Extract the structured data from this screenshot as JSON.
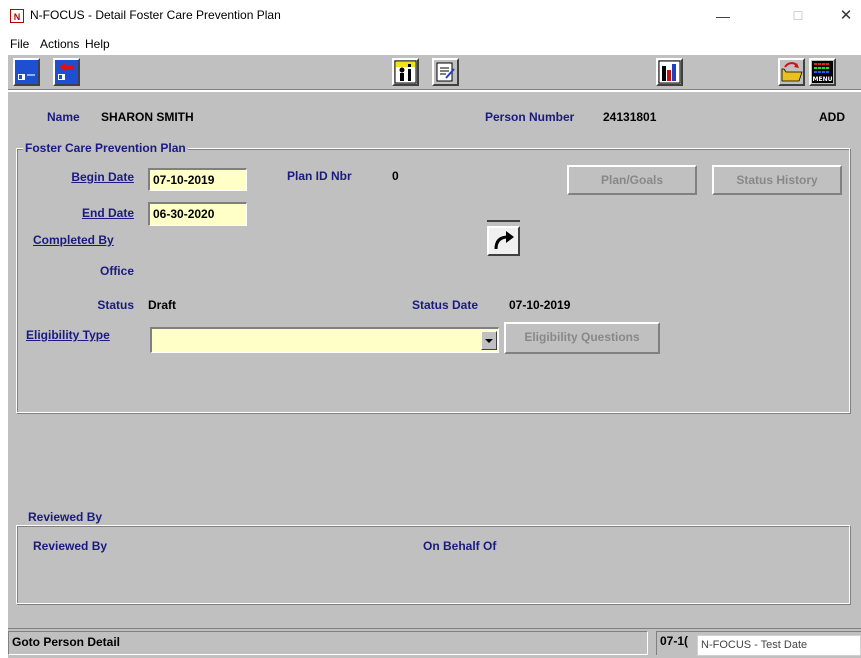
{
  "window": {
    "icon_letter": "N",
    "title": "N-FOCUS - Detail Foster Care Prevention Plan",
    "min_glyph": "—",
    "max_glyph": "☐",
    "close_glyph": "✕"
  },
  "menu": [
    "File",
    "Actions",
    "Help"
  ],
  "toolbar": {
    "icons": [
      "save-icon",
      "exit-icon",
      "person-info-icon",
      "notes-icon",
      "chart-icon",
      "open-folder-icon",
      "menu-icon"
    ],
    "menu_icon_text": "MENU"
  },
  "header": {
    "name_label": "Name",
    "name_value": "SHARON SMITH",
    "person_number_label": "Person Number",
    "person_number_value": "24131801",
    "mode": "ADD"
  },
  "plan": {
    "group_title": "Foster Care Prevention Plan",
    "begin_date_label": "Begin Date",
    "begin_date_value": "07-10-2019",
    "end_date_label": "End Date",
    "end_date_value": "06-30-2020",
    "plan_id_label": "Plan ID Nbr",
    "plan_id_value": "0",
    "completed_by_label": "Completed By",
    "office_label": "Office",
    "status_label": "Status",
    "status_value": "Draft",
    "status_date_label": "Status Date",
    "status_date_value": "07-10-2019",
    "eligibility_type_label": "Eligibility Type",
    "eligibility_type_value": "",
    "plan_goals_button": "Plan/Goals",
    "status_history_button": "Status History",
    "eligibility_questions_button": "Eligibility Questions"
  },
  "reviewed": {
    "group_title": "Reviewed By",
    "reviewed_by_label": "Reviewed By",
    "on_behalf_of_label": "On Behalf Of"
  },
  "statusbar": {
    "message": "Goto Person Detail",
    "date_fragment": "07-1(",
    "tooltip": "N-FOCUS - Test Date"
  }
}
